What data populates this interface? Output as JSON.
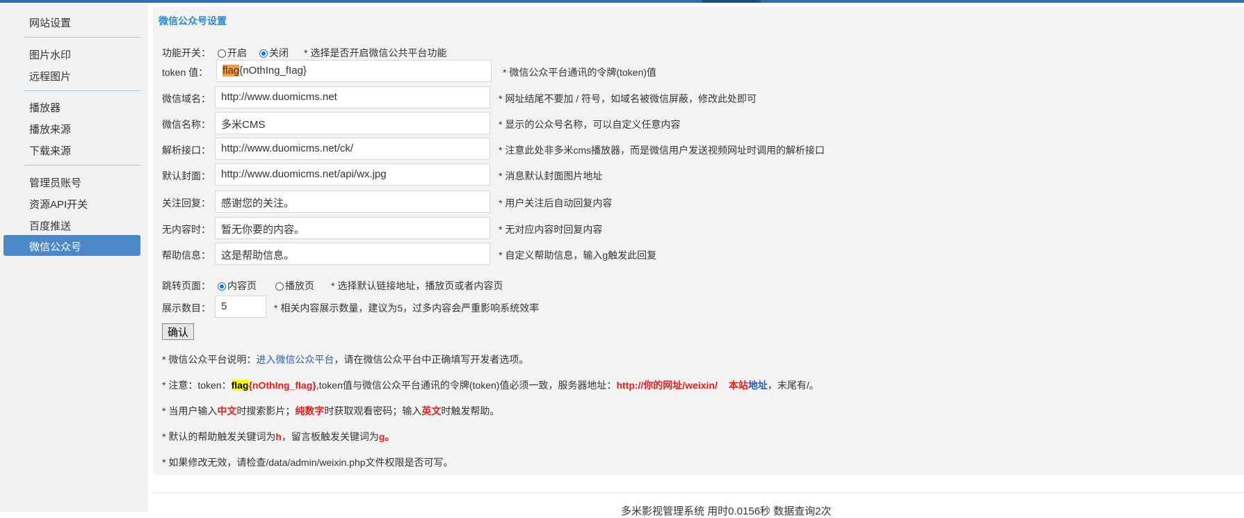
{
  "sidebar": {
    "items": [
      {
        "label": "网站设置"
      },
      {
        "label": "图片水印"
      },
      {
        "label": "远程图片"
      },
      {
        "label": "播放器"
      },
      {
        "label": "播放来源"
      },
      {
        "label": "下载来源"
      },
      {
        "label": "管理员账号"
      },
      {
        "label": "资源API开关"
      },
      {
        "label": "百度推送"
      },
      {
        "label": "微信公众号",
        "active": true
      }
    ]
  },
  "panel": {
    "title": "微信公众号设置",
    "switch": {
      "label": "功能开关：",
      "options": [
        "开启",
        "关闭"
      ],
      "selected": "关闭",
      "hint": "* 选择是否开启微信公共平台功能"
    },
    "fields": [
      {
        "label": "token 值：",
        "value_prefix": "flag",
        "value_rest": "{nOthIng_fIag}",
        "hint": "* 微信公众平台通讯的令牌(token)值"
      },
      {
        "label": "微信域名：",
        "value": "http://www.duomicms.net",
        "hint": "* 网址结尾不要加 / 符号，如域名被微信屏蔽，修改此处即可"
      },
      {
        "label": "微信名称：",
        "value": "多米CMS",
        "hint": "* 显示的公众号名称，可以自定义任意内容"
      },
      {
        "label": "解析接口：",
        "value": "http://www.duomicms.net/ck/",
        "hint": "* 注意此处非多米cms播放器，而是微信用户发送视频网址时调用的解析接口"
      },
      {
        "label": "默认封面：",
        "value": "http://www.duomicms.net/api/wx.jpg",
        "hint": "* 消息默认封面图片地址"
      },
      {
        "label": "关注回复：",
        "value": "感谢您的关注。",
        "hint": "* 用户关注后自动回复内容"
      },
      {
        "label": "无内容时：",
        "value": "暂无你要的内容。",
        "hint": "* 无对应内容时回复内容"
      },
      {
        "label": "帮助信息：",
        "value": "这是帮助信息。",
        "hint": "* 自定义帮助信息，输入g触发此回复"
      }
    ],
    "jump": {
      "label": "跳转页面：",
      "options": [
        "内容页",
        "播放页"
      ],
      "selected": "内容页",
      "hint": "* 选择默认链接地址，播放页或者内容页"
    },
    "count": {
      "label": "展示数目：",
      "value": "5",
      "hint": "* 相关内容展示数量，建议为5，过多内容会严重影响系统效率"
    },
    "confirm_label": "确认",
    "notes": {
      "n1_prefix": "* 微信公众平台说明：",
      "n1_link": "进入微信公众平台",
      "n1_suffix": "，请在微信公众平台中正确填写开发者选项。",
      "n2_prefix": "* 注意：token：",
      "n2_flag": "flag",
      "n2_token_rest": "{nOthIng_fIag}",
      "n2_middle": ",token值与微信公众平台通讯的令牌(token)值必须一致，服务器地址：",
      "n2_url": "http://你的网址/weixin/",
      "n2_site": "本站",
      "n2_site_link": "地址",
      "n2_suffix": "，末尾有/。",
      "n3_a": "* 当用户输入",
      "n3_b": "中文",
      "n3_c": "时搜索影片；",
      "n3_d": "纯数字",
      "n3_e": "时获取观看密码；输入",
      "n3_f": "英文",
      "n3_g": "时触发帮助。",
      "n4_a": "* 默认的帮助触发关键词为",
      "n4_b": "h",
      "n4_c": "，留言板触发关键词为",
      "n4_d": "g。",
      "n5": "* 如果修改无效，请检查/data/admin/weixin.php文件权限是否可写。"
    }
  },
  "footer": {
    "text": "多米影视管理系统 用时0.0156秒 数据查询2次"
  }
}
